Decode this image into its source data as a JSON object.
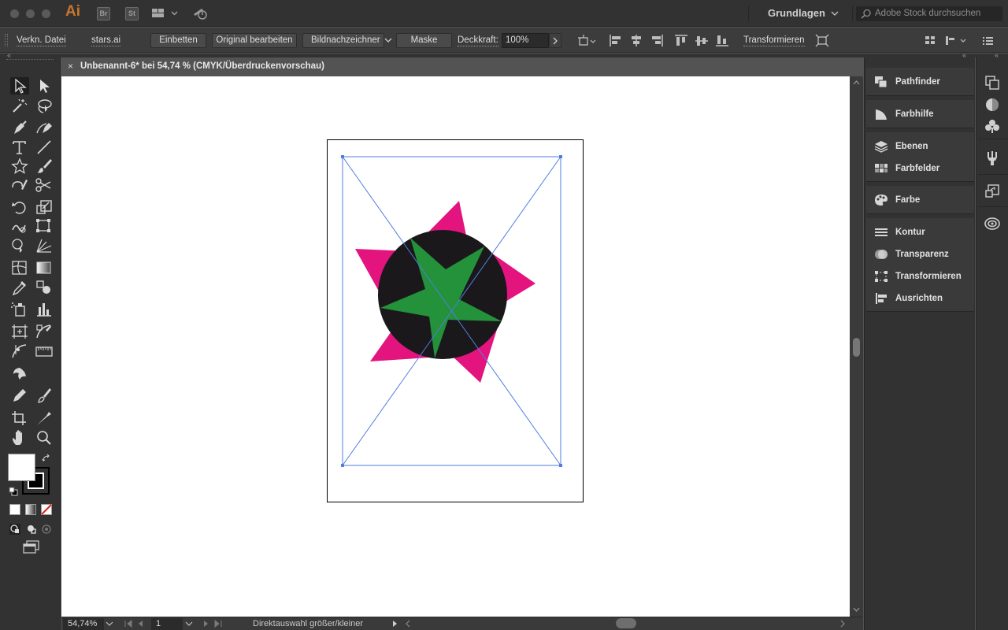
{
  "app": {
    "logo": "Ai",
    "bridge_label": "Br",
    "stock_label": "St",
    "workspace": "Grundlagen",
    "stock_search_placeholder": "Adobe Stock durchsuchen"
  },
  "control_bar": {
    "linked_file_label": "Verkn. Datei",
    "file_name": "stars.ai",
    "embed_button": "Einbetten",
    "edit_original_button": "Original bearbeiten",
    "image_trace_button": "Bildnachzeichner",
    "mask_button": "Maske",
    "opacity_label": "Deckkraft:",
    "opacity_value": "100%",
    "transform_link": "Transformieren"
  },
  "document": {
    "tab_title": "Unbenannt-6* bei 54,74 % (CMYK/Überdruckenvorschau)",
    "close_glyph": "×"
  },
  "status_bar": {
    "zoom": "54,74%",
    "artboard_number": "1",
    "status_text": "Direktauswahl größer/kleiner"
  },
  "panels": [
    {
      "label": "Pathfinder",
      "icon": "pathfinder-icon"
    },
    {
      "label": "Farbhilfe",
      "icon": "color-guide-icon"
    },
    {
      "label": "Ebenen",
      "icon": "layers-icon"
    },
    {
      "label": "Farbfelder",
      "icon": "swatches-icon"
    },
    {
      "label": "Farbe",
      "icon": "color-palette-icon"
    },
    {
      "label": "Kontur",
      "icon": "stroke-icon"
    },
    {
      "label": "Transparenz",
      "icon": "transparency-icon"
    },
    {
      "label": "Transformieren",
      "icon": "transform-icon"
    },
    {
      "label": "Ausrichten",
      "icon": "align-icon"
    }
  ],
  "colors": {
    "magenta_star": "#e4147f",
    "black_circle": "#1b181c",
    "green_star": "#23923a",
    "selection_blue": "#4f7ee0"
  }
}
